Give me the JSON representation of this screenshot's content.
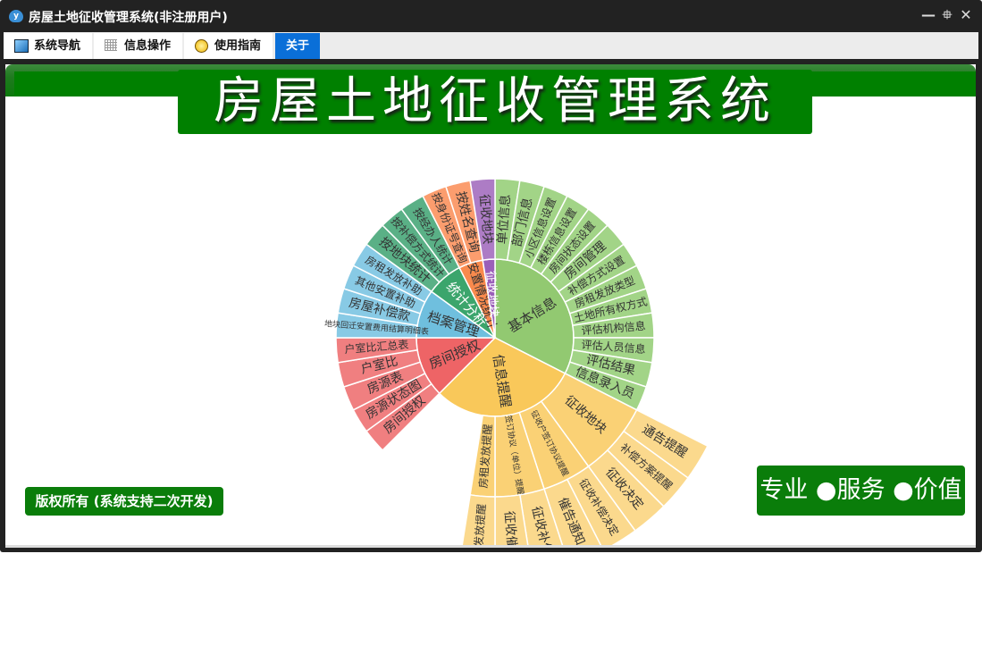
{
  "window": {
    "title": "房屋土地征收管理系统(非注册用户)",
    "icon": "app-logo-icon",
    "controls": {
      "minimize": "—",
      "restore": "⯐",
      "close": "✕"
    }
  },
  "tabs": [
    {
      "label": "系统导航",
      "icon": "monitor-icon",
      "active": false
    },
    {
      "label": "信息操作",
      "icon": "grid-icon",
      "active": false
    },
    {
      "label": "使用指南",
      "icon": "help-icon",
      "active": false
    },
    {
      "label": "关于",
      "active": true
    }
  ],
  "main": {
    "banner_title": "房屋土地征收管理系统",
    "copyright": "版权所有 (系统支持二次开发)",
    "slogan": "专业 ●服务 ●价值",
    "sunburst": [
      {
        "name": "基本信息",
        "color": "#92c971",
        "leafColor": "#a2d487",
        "value": 13,
        "children": [
          {
            "name": "单位信息"
          },
          {
            "name": "部门信息"
          },
          {
            "name": "小区信息设置"
          },
          {
            "name": "楼栋信息设置"
          },
          {
            "name": "房间状态设置"
          },
          {
            "name": "房间管理"
          },
          {
            "name": "补偿方式设置"
          },
          {
            "name": "房租发放类型"
          },
          {
            "name": "土地所有权方式"
          },
          {
            "name": "评估机构信息"
          },
          {
            "name": "评估人员信息"
          },
          {
            "name": "评估结果"
          },
          {
            "name": "信息录入员"
          }
        ]
      },
      {
        "name": "信息提醒",
        "color": "#f9c85a",
        "leafColor": "#fad175",
        "leaf2Color": "#fbd98d",
        "value": 12,
        "children": [
          {
            "name": "征收地块",
            "children": [
              {
                "name": "通告提醒"
              },
              {
                "name": "补偿方案提醒"
              },
              {
                "name": "征收决定"
              }
            ]
          },
          {
            "name": "征收户签订协议提醒",
            "children": [
              {
                "name": "征收补偿决定"
              },
              {
                "name": "催告通知"
              }
            ]
          },
          {
            "name": "签订协议（单位）提醒",
            "children": [
              {
                "name": "征收补偿"
              },
              {
                "name": "征收催告"
              }
            ]
          },
          {
            "name": "房租发放提醒",
            "children": [
              {
                "name": "房租发放提醒"
              }
            ]
          }
        ]
      },
      {
        "name": "房间授权",
        "color": "#ee6466",
        "leafColor": "#f07f80",
        "value": 5,
        "children": [
          {
            "name": "房间授权"
          },
          {
            "name": "房源状态图"
          },
          {
            "name": "房源表"
          },
          {
            "name": "户室比"
          },
          {
            "name": "户室比汇总表"
          }
        ]
      },
      {
        "name": "档案管理",
        "color": "#6fbfde",
        "leafColor": "#88cae5",
        "value": 4,
        "children": [
          {
            "name": "地块回迁安置费用结算明细表"
          },
          {
            "name": "房屋补偿款"
          },
          {
            "name": "其他安置补助"
          },
          {
            "name": "房租发放补助"
          }
        ]
      },
      {
        "name": "统计分析",
        "color": "#3ba56c",
        "leafColor": "#5ab086",
        "textColor": "#ffffff",
        "value": 3,
        "children": [
          {
            "name": "按地块统计"
          },
          {
            "name": "按补偿方式统计"
          },
          {
            "name": "按经办人统计"
          }
        ]
      },
      {
        "name": "安置情况统计",
        "color": "#f98a4d",
        "leafColor": "#fb9d6e",
        "value": 2,
        "children": [
          {
            "name": "按身份证号查询"
          },
          {
            "name": "按姓名查询"
          }
        ]
      },
      {
        "name": "征收地块",
        "color": "#9b5fb9",
        "leafColor": "#ad7cc5",
        "textColor": "#ffffff",
        "value": 1,
        "children": [
          {
            "name": "征收地块"
          }
        ]
      }
    ]
  }
}
